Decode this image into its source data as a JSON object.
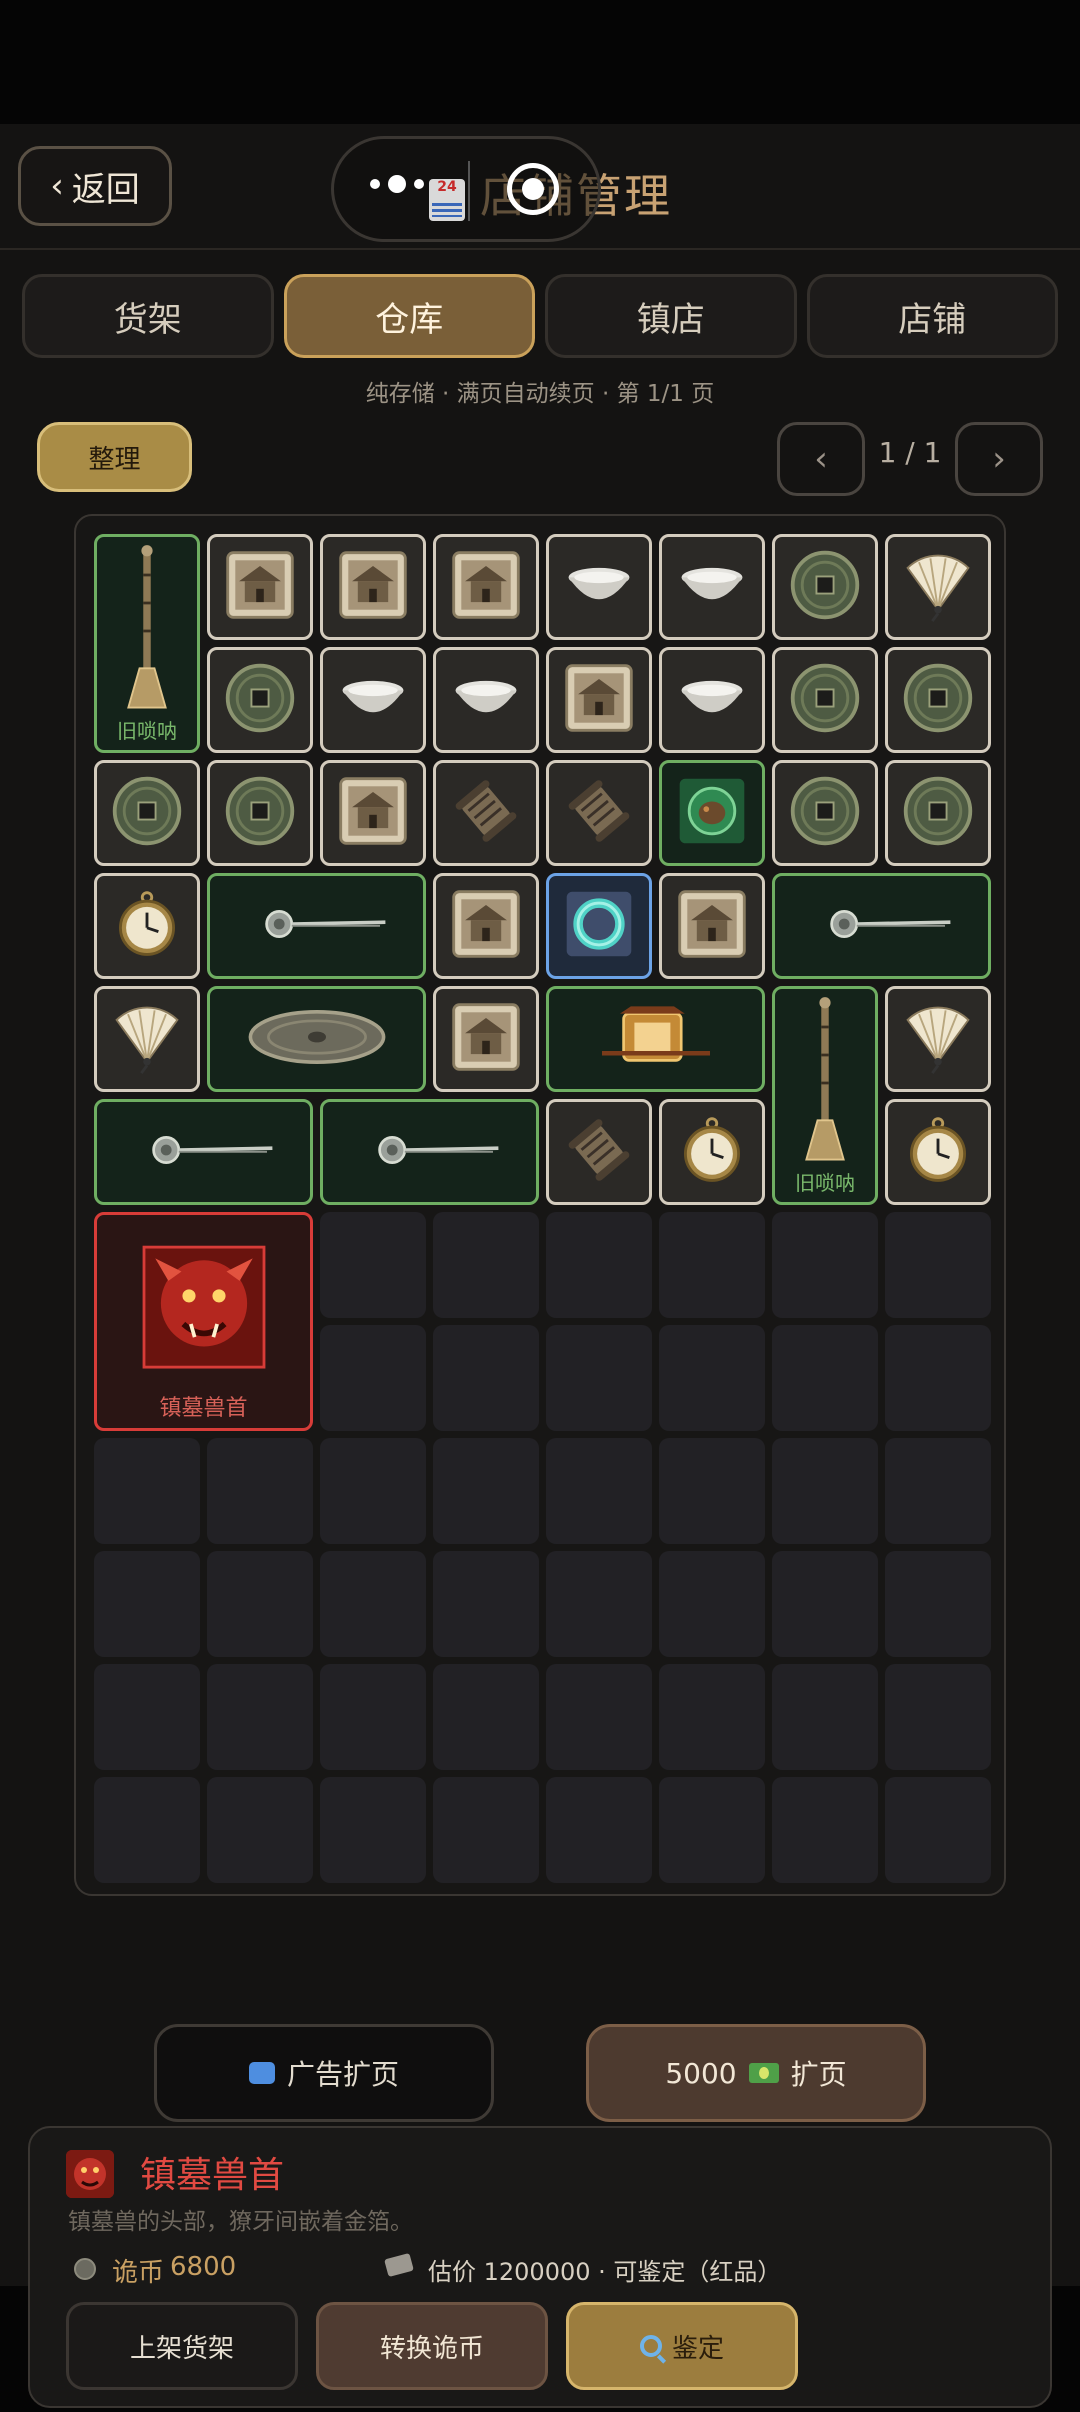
{
  "colors": {
    "accent_gold": "#caa15a",
    "rare_green": "#6fae62",
    "epic_blue": "#6ca3e6",
    "legend_red": "#d83c38"
  },
  "header": {
    "back_label": "返回",
    "title": "店铺管理",
    "mini_badge": "24"
  },
  "tabs": [
    {
      "label": "货架",
      "active": false
    },
    {
      "label": "仓库",
      "active": true
    },
    {
      "label": "镇店",
      "active": false
    },
    {
      "label": "店铺",
      "active": false
    }
  ],
  "subtitle": "纯存储 · 满页自动续页 · 第 1/1 页",
  "toolbar": {
    "sort_label": "整理",
    "prev": "‹",
    "next": "›",
    "page": "1 / 1"
  },
  "grid": {
    "cols": 8,
    "rows": 12,
    "items": [
      {
        "name": "旧唢呐",
        "icon": "suona-icon",
        "col": 0,
        "row": 0,
        "w": 1,
        "h": 2,
        "rarity": "green",
        "label": "旧唢呐"
      },
      {
        "name": "古宅画",
        "icon": "mansion-tile-icon",
        "col": 1,
        "row": 0,
        "w": 1,
        "h": 1,
        "rarity": "white"
      },
      {
        "name": "古宅画",
        "icon": "mansion-tile-icon",
        "col": 2,
        "row": 0,
        "w": 1,
        "h": 1,
        "rarity": "white"
      },
      {
        "name": "古宅画",
        "icon": "mansion-tile-icon",
        "col": 3,
        "row": 0,
        "w": 1,
        "h": 1,
        "rarity": "white"
      },
      {
        "name": "瓷碗",
        "icon": "bowl-icon",
        "col": 4,
        "row": 0,
        "w": 1,
        "h": 1,
        "rarity": "white"
      },
      {
        "name": "瓷碗",
        "icon": "bowl-icon",
        "col": 5,
        "row": 0,
        "w": 1,
        "h": 1,
        "rarity": "white"
      },
      {
        "name": "铜钱",
        "icon": "coin-icon",
        "col": 6,
        "row": 0,
        "w": 1,
        "h": 1,
        "rarity": "white"
      },
      {
        "name": "折扇",
        "icon": "fan-icon",
        "col": 7,
        "row": 0,
        "w": 1,
        "h": 1,
        "rarity": "white"
      },
      {
        "name": "铜钱",
        "icon": "coin-icon",
        "col": 1,
        "row": 1,
        "w": 1,
        "h": 1,
        "rarity": "white"
      },
      {
        "name": "瓷碗",
        "icon": "bowl-icon",
        "col": 2,
        "row": 1,
        "w": 1,
        "h": 1,
        "rarity": "white"
      },
      {
        "name": "瓷碗",
        "icon": "bowl-icon",
        "col": 3,
        "row": 1,
        "w": 1,
        "h": 1,
        "rarity": "white"
      },
      {
        "name": "古宅画",
        "icon": "mansion-tile-icon",
        "col": 4,
        "row": 1,
        "w": 1,
        "h": 1,
        "rarity": "white"
      },
      {
        "name": "瓷碗",
        "icon": "bowl-icon",
        "col": 5,
        "row": 1,
        "w": 1,
        "h": 1,
        "rarity": "white"
      },
      {
        "name": "铜钱",
        "icon": "coin-icon",
        "col": 6,
        "row": 1,
        "w": 1,
        "h": 1,
        "rarity": "white"
      },
      {
        "name": "铜钱",
        "icon": "coin-icon",
        "col": 7,
        "row": 1,
        "w": 1,
        "h": 1,
        "rarity": "white"
      },
      {
        "name": "铜钱",
        "icon": "coin-icon",
        "col": 0,
        "row": 2,
        "w": 1,
        "h": 1,
        "rarity": "white"
      },
      {
        "name": "铜钱",
        "icon": "coin-icon",
        "col": 1,
        "row": 2,
        "w": 1,
        "h": 1,
        "rarity": "white"
      },
      {
        "name": "古宅画",
        "icon": "mansion-tile-icon",
        "col": 2,
        "row": 2,
        "w": 1,
        "h": 1,
        "rarity": "white"
      },
      {
        "name": "卷轴",
        "icon": "scroll-icon",
        "col": 3,
        "row": 2,
        "w": 1,
        "h": 1,
        "rarity": "white"
      },
      {
        "name": "卷轴",
        "icon": "scroll-icon",
        "col": 4,
        "row": 2,
        "w": 1,
        "h": 1,
        "rarity": "white"
      },
      {
        "name": "翠铃",
        "icon": "jade-bell-icon",
        "col": 5,
        "row": 2,
        "w": 1,
        "h": 1,
        "rarity": "green"
      },
      {
        "name": "铜钱",
        "icon": "coin-icon",
        "col": 6,
        "row": 2,
        "w": 1,
        "h": 1,
        "rarity": "white"
      },
      {
        "name": "铜钱",
        "icon": "coin-icon",
        "col": 7,
        "row": 2,
        "w": 1,
        "h": 1,
        "rarity": "white"
      },
      {
        "name": "怀表",
        "icon": "pocket-watch-icon",
        "col": 0,
        "row": 3,
        "w": 1,
        "h": 1,
        "rarity": "white"
      },
      {
        "name": "发簪",
        "icon": "hairpin-icon",
        "col": 1,
        "row": 3,
        "w": 2,
        "h": 1,
        "rarity": "green"
      },
      {
        "name": "古宅画",
        "icon": "mansion-tile-icon",
        "col": 3,
        "row": 3,
        "w": 1,
        "h": 1,
        "rarity": "white"
      },
      {
        "name": "玉镯",
        "icon": "jade-bracelet-icon",
        "col": 4,
        "row": 3,
        "w": 1,
        "h": 1,
        "rarity": "blue"
      },
      {
        "name": "古宅画",
        "icon": "mansion-tile-icon",
        "col": 5,
        "row": 3,
        "w": 1,
        "h": 1,
        "rarity": "white"
      },
      {
        "name": "发簪",
        "icon": "hairpin-icon",
        "col": 6,
        "row": 3,
        "w": 2,
        "h": 1,
        "rarity": "green"
      },
      {
        "name": "折扇",
        "icon": "fan-icon",
        "col": 0,
        "row": 4,
        "w": 1,
        "h": 1,
        "rarity": "white"
      },
      {
        "name": "铜镜",
        "icon": "bronze-mirror-icon",
        "col": 1,
        "row": 4,
        "w": 2,
        "h": 1,
        "rarity": "green"
      },
      {
        "name": "古宅画",
        "icon": "mansion-tile-icon",
        "col": 3,
        "row": 4,
        "w": 1,
        "h": 1,
        "rarity": "white"
      },
      {
        "name": "轿辇",
        "icon": "lantern-palanquin-icon",
        "col": 4,
        "row": 4,
        "w": 2,
        "h": 1,
        "rarity": "green"
      },
      {
        "name": "旧唢呐",
        "icon": "suona-icon",
        "col": 6,
        "row": 4,
        "w": 1,
        "h": 2,
        "rarity": "green",
        "label": "旧唢呐"
      },
      {
        "name": "折扇",
        "icon": "fan-icon",
        "col": 7,
        "row": 4,
        "w": 1,
        "h": 1,
        "rarity": "white"
      },
      {
        "name": "发簪",
        "icon": "hairpin-icon",
        "col": 0,
        "row": 5,
        "w": 2,
        "h": 1,
        "rarity": "green"
      },
      {
        "name": "发簪",
        "icon": "hairpin-icon",
        "col": 2,
        "row": 5,
        "w": 2,
        "h": 1,
        "rarity": "green"
      },
      {
        "name": "卷轴",
        "icon": "scroll-icon",
        "col": 4,
        "row": 5,
        "w": 1,
        "h": 1,
        "rarity": "white"
      },
      {
        "name": "怀表",
        "icon": "pocket-watch-icon",
        "col": 5,
        "row": 5,
        "w": 1,
        "h": 1,
        "rarity": "white"
      },
      {
        "name": "怀表",
        "icon": "pocket-watch-icon",
        "col": 7,
        "row": 5,
        "w": 1,
        "h": 1,
        "rarity": "white"
      },
      {
        "name": "镇墓兽首",
        "icon": "tomb-beast-head-icon",
        "col": 0,
        "row": 6,
        "w": 2,
        "h": 2,
        "rarity": "red",
        "label": "镇墓兽首"
      }
    ]
  },
  "expand": {
    "ad_label": "广告扩页",
    "buy_label": "5000",
    "buy_suffix": "扩页"
  },
  "detail": {
    "name": "镇墓兽首",
    "desc": "镇墓兽的头部，獠牙间嵌着金箔。",
    "coin_label": "诡币",
    "coin_value": "6800",
    "estimate": "估价 1200000 · 可鉴定（红品）",
    "btn_list": "上架货架",
    "btn_convert": "转换诡币",
    "btn_appraise": "鉴定"
  }
}
